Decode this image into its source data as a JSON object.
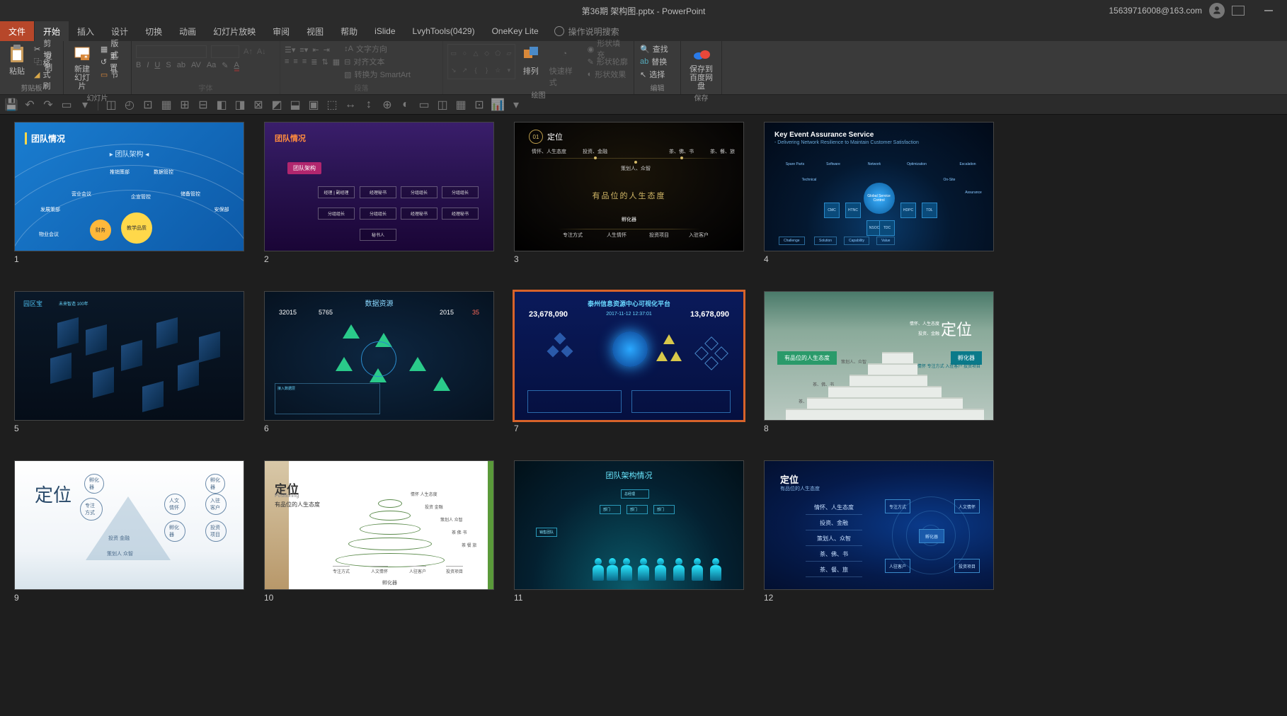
{
  "titlebar": {
    "filename": "第36期 架构图.pptx",
    "app": "PowerPoint",
    "user": "15639716008@163.com"
  },
  "menu": {
    "file": "文件",
    "home": "开始",
    "insert": "插入",
    "design": "设计",
    "transition": "切换",
    "animation": "动画",
    "slideshow": "幻灯片放映",
    "review": "审阅",
    "view": "视图",
    "help": "帮助",
    "islide": "iSlide",
    "lvyh": "LvyhTools(0429)",
    "onekey": "OneKey Lite",
    "tellme": "操作说明搜索"
  },
  "ribbon": {
    "clipboard": {
      "label": "剪贴板",
      "paste": "粘贴",
      "cut": "剪切",
      "copy": "复制",
      "painter": "格式刷"
    },
    "slides": {
      "label": "幻灯片",
      "new": "新建\n幻灯片",
      "layout": "版式",
      "reset": "重置",
      "section": "节"
    },
    "font": {
      "label": "字体"
    },
    "paragraph": {
      "label": "段落",
      "textdir": "文字方向",
      "align": "对齐文本",
      "smartart": "转换为 SmartArt"
    },
    "drawing": {
      "label": "绘图",
      "arrange": "排列",
      "quickstyle": "快速样式",
      "fill": "形状填充",
      "outline": "形状轮廓",
      "effects": "形状效果"
    },
    "editing": {
      "label": "编辑",
      "find": "查找",
      "replace": "替换",
      "select": "选择"
    },
    "save": {
      "label": "保存",
      "savebaidu": "保存到\n百度网盘"
    }
  },
  "slides": [
    {
      "num": "1",
      "title": "团队情况",
      "subtitle": "▸ 团队架构 ◂",
      "center": "教学品质",
      "n1": "物业会议",
      "n2": "财务",
      "n3": "营业会议",
      "n4": "发展策部",
      "n5": "推销策部",
      "n6": "数据管控",
      "n7": "企宣管控",
      "n8": "储备管控",
      "n9": "安保部"
    },
    {
      "num": "2",
      "title": "团队情况",
      "badge": "团队架构",
      "b1": "经理 | 副经理",
      "b2": "经理秘书",
      "b3": "分组组长",
      "b4": "分组组长",
      "b5": "分组组长",
      "b6": "分组组长",
      "b7": "经理秘书",
      "b8": "经理秘书",
      "b9": "秘书人"
    },
    {
      "num": "3",
      "numbadge": "01",
      "title": "定位",
      "center": "有品位的人生态度",
      "t1": "情怀、人生态度",
      "t2": "投资、金融",
      "t3": "策划人、众智",
      "t4": "茶、佛、书",
      "t5": "茶、餐、旅",
      "sub": "孵化器",
      "b1": "专注方式",
      "b2": "人生情怀",
      "b3": "投资项目",
      "b4": "入驻客户"
    },
    {
      "num": "4",
      "title": "Key Event Assurance Service",
      "sub": "- Delivering Network Resilience to Maintain Customer Satisfaction",
      "center": "Global Service Control",
      "h1": "CMC",
      "h2": "HTNC",
      "h3": "NSOC",
      "h4": "TDL",
      "h5": "HDPC",
      "h6": "TDC",
      "i1": "Spare Parts",
      "i2": "Technical",
      "i3": "Software",
      "i4": "Network",
      "i5": "Optimization",
      "i6": "On-Site",
      "i7": "Escalation",
      "i8": "Assurance",
      "bb1": "Challenge",
      "bb2": "Solution",
      "bb3": "Capability",
      "bb4": "Value"
    },
    {
      "num": "5",
      "title": "园区宝",
      "sub": "未来智造 100年"
    },
    {
      "num": "6",
      "title": "数据资源",
      "s1": "32015",
      "s2": "5765",
      "s3": "2015",
      "s4": "35"
    },
    {
      "num": "7",
      "title": "泰州信息资源中心可视化平台",
      "left": "23,678,090",
      "right": "13,678,090",
      "date": "2017-11-12  12:37:01"
    },
    {
      "num": "8",
      "title": "定位",
      "bar1": "有品位的人生态度",
      "bar2": "孵化器",
      "t1": "情怀、人生态度",
      "t2": "投资、金融",
      "t3": "策划人、众智",
      "t4": "茶、佛、书",
      "t5": "茶、餐、旅",
      "b1": "人文情怀  专注方式 入驻客户 投资项目"
    },
    {
      "num": "9",
      "title": "定位",
      "c1": "孵化器",
      "c2": "专注方式",
      "c3": "孵化器",
      "c4": "人文情怀",
      "c5": "入驻客户",
      "c6": "孵化器",
      "c7": "投资 金融",
      "c8": "投资项目",
      "c9": "策划人 众智"
    },
    {
      "num": "10",
      "title": "定位",
      "eng": "Positioning",
      "sub": "有品位的人生态度",
      "l1": "专注方式",
      "l2": "投资项目",
      "l3": "人文情怀",
      "l4": "人驻客户",
      "btm": "孵化器",
      "r1": "情怀 人生态度",
      "r2": "投资 金融",
      "r3": "策划人 众智",
      "r4": "茶 佛 书",
      "r5": "茶 餐 旅"
    },
    {
      "num": "11",
      "title": "团队架构情况"
    },
    {
      "num": "12",
      "title": "定位",
      "sub": "有品位的人生态度",
      "r1": "情怀、人生态度",
      "r2": "投资、金融",
      "r3": "策划人、众智",
      "r4": "茶、佛、书",
      "r5": "茶、餐、旅",
      "c": "孵化器",
      "h1": "专注方式",
      "h2": "人文情怀",
      "h3": "人驻客户",
      "h4": "投资项目"
    }
  ]
}
